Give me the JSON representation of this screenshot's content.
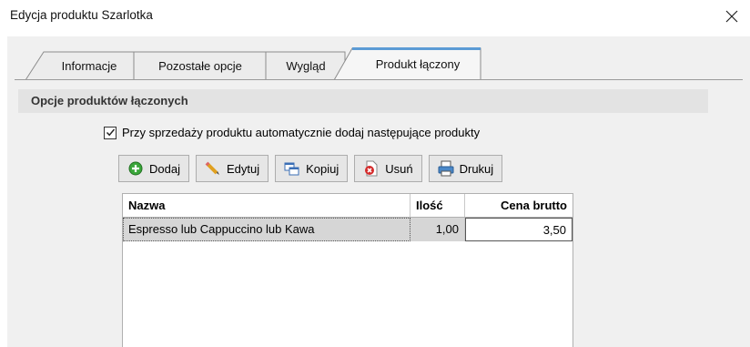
{
  "window": {
    "title": "Edycja produktu Szarlotka"
  },
  "tabs": [
    {
      "label": "Informacje"
    },
    {
      "label": "Pozostałe opcje"
    },
    {
      "label": "Wygląd"
    },
    {
      "label": "Produkt łączony",
      "active": true
    }
  ],
  "section": {
    "title": "Opcje produktów łączonych"
  },
  "checkbox": {
    "label": "Przy sprzedaży produktu automatycznie dodaj następujące produkty",
    "checked": true
  },
  "toolbar": {
    "add": "Dodaj",
    "edit": "Edytuj",
    "copy": "Kopiuj",
    "delete": "Usuń",
    "print": "Drukuj"
  },
  "table": {
    "columns": [
      "Nazwa",
      "Ilość",
      "Cena brutto"
    ],
    "rows": [
      {
        "name": "Espresso lub Cappuccino lub Kawa",
        "qty": "1,00",
        "price": "3,50"
      }
    ]
  },
  "colors": {
    "active_tab_border": "#5b9bd5",
    "panel_bg": "#f0f0f0",
    "section_bg": "#e3e3e3"
  }
}
